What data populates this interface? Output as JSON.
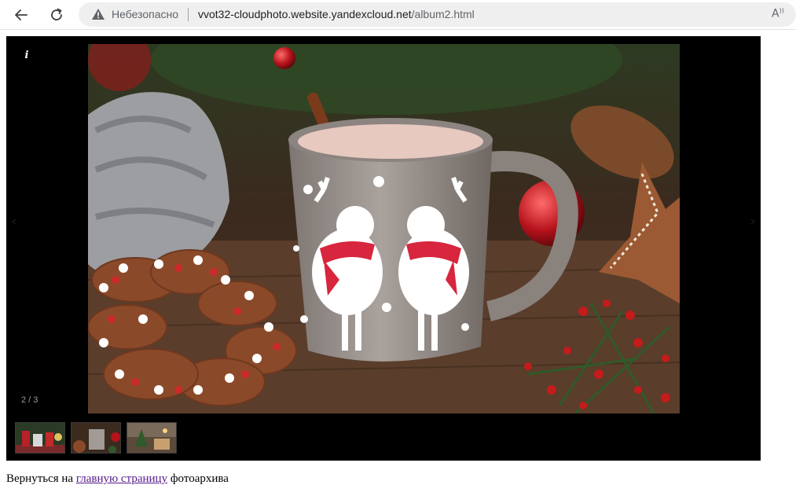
{
  "browser": {
    "security_label": "Небезопасно",
    "url_host": "vvot32-cloudphoto.website.yandexcloud.net",
    "url_path": "/album2.html",
    "icons": {
      "back": "back-arrow-icon",
      "reload": "reload-icon",
      "security": "warning-triangle-icon",
      "reader": "read-aloud-icon"
    }
  },
  "gallery": {
    "info_label": "i",
    "counter": "2 / 3",
    "current_index": 2,
    "total": 3,
    "background": "#000000",
    "thumbnails": [
      {
        "index": 1
      },
      {
        "index": 2
      },
      {
        "index": 3
      }
    ]
  },
  "footer": {
    "prefix": "Вернуться на",
    "link_text": "главную страницу",
    "suffix": "фотоархива",
    "link_color": "#551a8b"
  }
}
